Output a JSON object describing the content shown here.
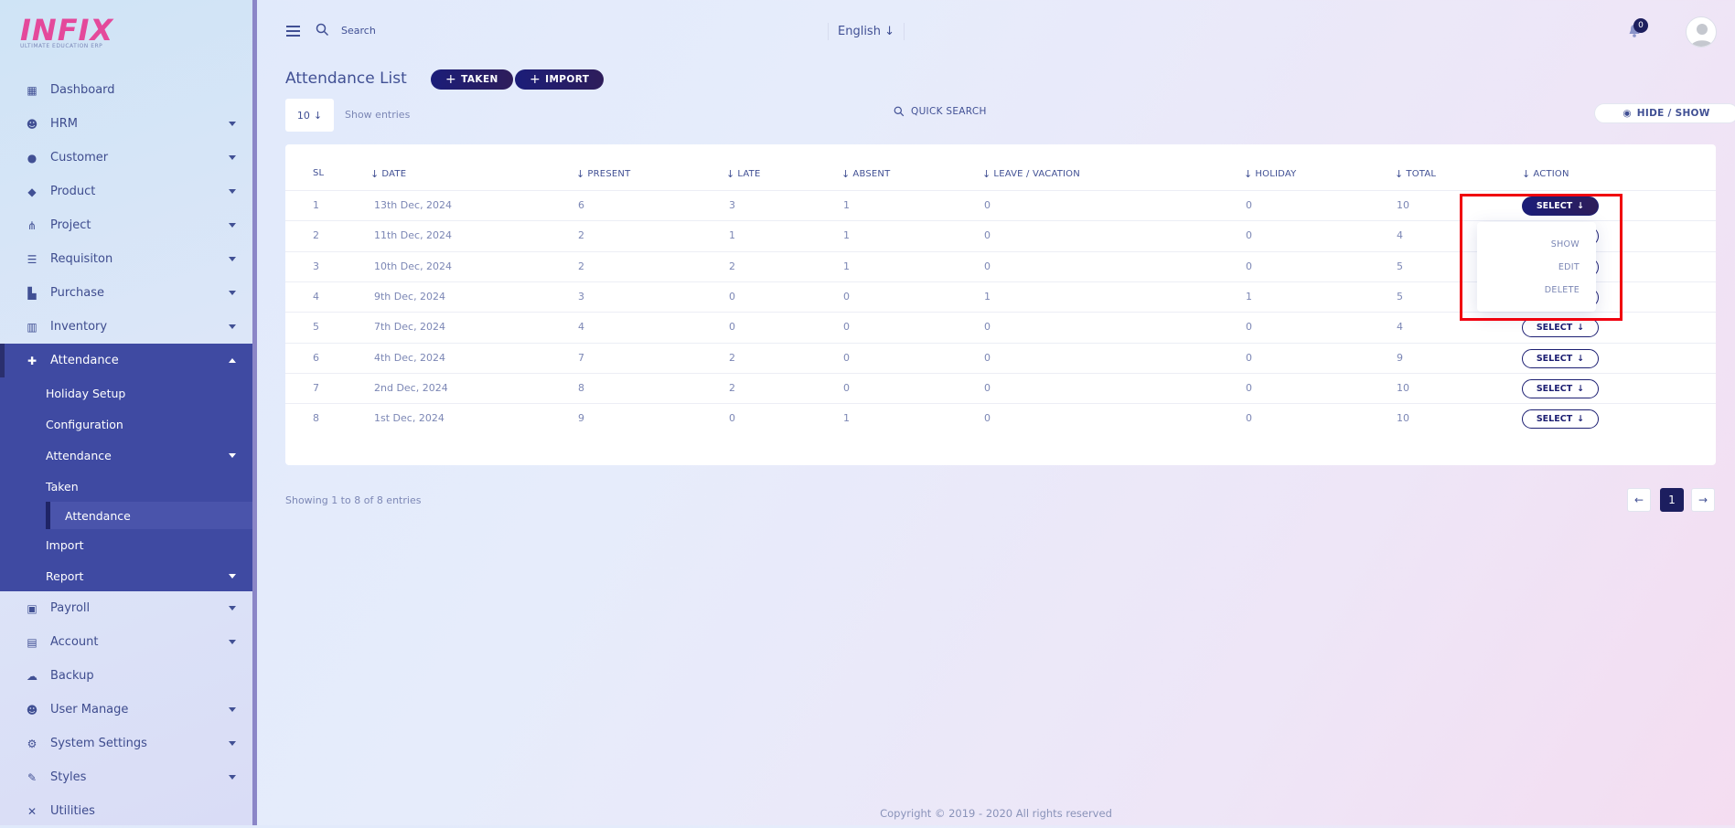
{
  "brand": {
    "logo": "INFIX",
    "tagline": "ULTIMATE EDUCATION ERP"
  },
  "sidebar": {
    "items": [
      {
        "label": "Dashboard",
        "icon": "grid-icon"
      },
      {
        "label": "HRM",
        "icon": "people-icon"
      },
      {
        "label": "Customer",
        "icon": "user-icon"
      },
      {
        "label": "Product",
        "icon": "tag-icon"
      },
      {
        "label": "Project",
        "icon": "nodes-icon"
      },
      {
        "label": "Requisiton",
        "icon": "list-icon"
      },
      {
        "label": "Purchase",
        "icon": "cart-icon"
      },
      {
        "label": "Inventory",
        "icon": "barcode-icon"
      }
    ],
    "attendance": {
      "label": "Attendance",
      "children": {
        "holiday": "Holiday Setup",
        "configuration": "Configuration",
        "attendance": "Attendance",
        "taken": "Taken",
        "attendance_sub": "Attendance",
        "import": "Import",
        "report": "Report"
      }
    },
    "items_after": [
      {
        "label": "Payroll",
        "icon": "money-icon"
      },
      {
        "label": "Account",
        "icon": "calculator-icon"
      },
      {
        "label": "Backup",
        "icon": "cloud-icon"
      },
      {
        "label": "User Manage",
        "icon": "users-icon"
      },
      {
        "label": "System Settings",
        "icon": "gear-icon"
      },
      {
        "label": "Styles",
        "icon": "brush-icon"
      },
      {
        "label": "Utilities",
        "icon": "tools-icon"
      }
    ]
  },
  "topbar": {
    "search_placeholder": "Search",
    "language": "English",
    "notifications": "0"
  },
  "page": {
    "title": "Attendance List",
    "taken_btn": "TAKEN",
    "import_btn": "IMPORT",
    "entries_value": "10",
    "entries_label": "Show entries",
    "quick_search": "QUICK SEARCH",
    "hide_show": "HIDE / SHOW"
  },
  "table": {
    "headers": {
      "sl": "SL",
      "date": "DATE",
      "present": "PRESENT",
      "late": "LATE",
      "absent": "ABSENT",
      "leave": "LEAVE / VACATION",
      "holiday": "HOLIDAY",
      "total": "TOTAL",
      "action": "ACTION"
    },
    "select_label": "SELECT",
    "rows": [
      {
        "sl": "1",
        "date": "13th Dec, 2024",
        "present": "6",
        "late": "3",
        "absent": "1",
        "leave": "0",
        "holiday": "0",
        "total": "10"
      },
      {
        "sl": "2",
        "date": "11th Dec, 2024",
        "present": "2",
        "late": "1",
        "absent": "1",
        "leave": "0",
        "holiday": "0",
        "total": "4"
      },
      {
        "sl": "3",
        "date": "10th Dec, 2024",
        "present": "2",
        "late": "2",
        "absent": "1",
        "leave": "0",
        "holiday": "0",
        "total": "5"
      },
      {
        "sl": "4",
        "date": "9th Dec, 2024",
        "present": "3",
        "late": "0",
        "absent": "0",
        "leave": "1",
        "holiday": "1",
        "total": "5"
      },
      {
        "sl": "5",
        "date": "7th Dec, 2024",
        "present": "4",
        "late": "0",
        "absent": "0",
        "leave": "0",
        "holiday": "0",
        "total": "4"
      },
      {
        "sl": "6",
        "date": "4th Dec, 2024",
        "present": "7",
        "late": "2",
        "absent": "0",
        "leave": "0",
        "holiday": "0",
        "total": "9"
      },
      {
        "sl": "7",
        "date": "2nd Dec, 2024",
        "present": "8",
        "late": "2",
        "absent": "0",
        "leave": "0",
        "holiday": "0",
        "total": "10"
      },
      {
        "sl": "8",
        "date": "1st Dec, 2024",
        "present": "9",
        "late": "0",
        "absent": "1",
        "leave": "0",
        "holiday": "0",
        "total": "10"
      }
    ],
    "dropdown": {
      "show": "SHOW",
      "edit": "EDIT",
      "delete": "DELETE"
    }
  },
  "footer": {
    "showing": "Showing 1 to 8 of 8 entries",
    "page": "1",
    "copyright": "Copyright © 2019 - 2020 All rights reserved"
  },
  "colors": {
    "accent": "#1c1e72",
    "sidebar_active": "#3f4aa2",
    "highlight": "#f0000f"
  }
}
